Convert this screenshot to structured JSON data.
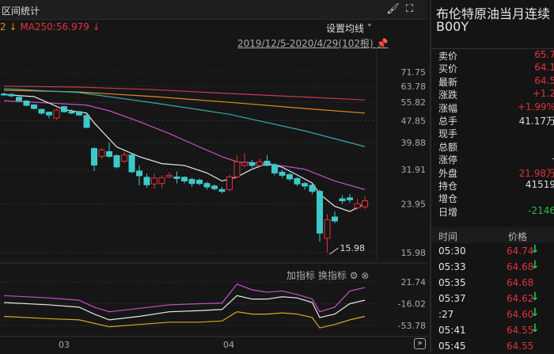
{
  "header": {
    "title": "区间统计",
    "brush_icon": "brush-icon",
    "fullscreen_icon": "fullscreen-icon"
  },
  "ma_legend": {
    "prefix": "2 ↓",
    "ma250": "MA250:56.979 ↓"
  },
  "set_ma": "设置均线 ˅",
  "range": "2019/12/5-2020/4/29(102根)",
  "indicator_tools": {
    "add": "加指标",
    "switch": "换指标"
  },
  "x_labels": [
    "03",
    "04"
  ],
  "colors": {
    "up": "#e0313d",
    "down": "#3ec9c9",
    "ma5": "#e8e8e8",
    "ma10": "#c84fc8",
    "ma20": "#3aa8a8",
    "ma60": "#e08a1e",
    "ma250": "#c83a55"
  },
  "chart_data": {
    "type": "candlestick",
    "y_ticks": [
      71.75,
      63.78,
      55.82,
      47.85,
      39.88,
      31.91,
      23.95,
      15.98
    ],
    "ylim": [
      15.98,
      71.75
    ],
    "min_marker": "15.98",
    "candles": [
      [
        59.8,
        59.3,
        60.5,
        58.8
      ],
      [
        59.6,
        58.9,
        60.2,
        58.2
      ],
      [
        58.2,
        56.6,
        58.6,
        55.8
      ],
      [
        56.4,
        54.4,
        56.8,
        54.0
      ],
      [
        54.6,
        53.0,
        55.0,
        52.6
      ],
      [
        52.6,
        51.0,
        53.0,
        50.4
      ],
      [
        51.4,
        50.2,
        51.6,
        48.8
      ],
      [
        48.9,
        52.3,
        53.0,
        48.2
      ],
      [
        53.8,
        51.6,
        54.2,
        51.2
      ],
      [
        51.6,
        51.0,
        52.6,
        50.6
      ],
      [
        51.6,
        50.2,
        52.0,
        49.8
      ],
      [
        50.0,
        45.3,
        50.4,
        45.0
      ],
      [
        38.0,
        33.1,
        38.4,
        31.5
      ],
      [
        35.6,
        37.5,
        38.2,
        34.8
      ],
      [
        37.0,
        35.6,
        40.0,
        35.2
      ],
      [
        35.8,
        32.6,
        36.2,
        32.2
      ],
      [
        34.2,
        36.0,
        37.0,
        33.6
      ],
      [
        36.0,
        31.3,
        36.4,
        31.0
      ],
      [
        31.5,
        30.3,
        33.0,
        28.0
      ],
      [
        29.9,
        28.1,
        30.8,
        27.4
      ],
      [
        28.3,
        29.7,
        30.8,
        27.2
      ],
      [
        28.4,
        29.8,
        30.4,
        27.4
      ],
      [
        30.0,
        30.4,
        31.2,
        29.6
      ],
      [
        30.0,
        29.6,
        31.4,
        28.4
      ],
      [
        29.9,
        29.0,
        30.2,
        28.4
      ],
      [
        29.4,
        28.4,
        29.8,
        27.6
      ],
      [
        29.2,
        28.4,
        29.6,
        28.0
      ],
      [
        28.4,
        27.6,
        28.8,
        27.0
      ],
      [
        27.8,
        27.2,
        28.2,
        26.8
      ],
      [
        27.0,
        26.6,
        27.6,
        26.2
      ],
      [
        27.0,
        30.0,
        30.6,
        26.6
      ],
      [
        30.0,
        34.0,
        36.0,
        29.6
      ],
      [
        33.0,
        33.8,
        36.5,
        32.5
      ],
      [
        33.8,
        33.0,
        34.6,
        32.4
      ],
      [
        33.0,
        34.0,
        35.0,
        32.6
      ],
      [
        34.2,
        33.0,
        36.0,
        32.8
      ],
      [
        33.2,
        31.0,
        33.6,
        30.4
      ],
      [
        31.2,
        30.4,
        31.8,
        29.8
      ],
      [
        30.6,
        29.5,
        31.0,
        29.0
      ],
      [
        29.6,
        28.3,
        30.0,
        27.8
      ],
      [
        28.4,
        27.8,
        28.8,
        27.0
      ],
      [
        28.0,
        26.6,
        28.4,
        26.0
      ],
      [
        26.6,
        18.8,
        27.0,
        17.5
      ],
      [
        18.0,
        21.0,
        22.0,
        15.98
      ],
      [
        21.5,
        20.8,
        22.5,
        20.4
      ],
      [
        25.0,
        24.6,
        25.8,
        24.0
      ],
      [
        25.2,
        24.8,
        26.0,
        24.2
      ],
      [
        23.2,
        24.0,
        25.0,
        22.8
      ],
      [
        23.4,
        24.6,
        25.6,
        23.0
      ]
    ],
    "ma": {
      "ma5": [
        [
          0,
          59.5
        ],
        [
          4,
          58.5
        ],
        [
          8,
          52.5
        ],
        [
          11,
          51.0
        ],
        [
          12,
          47.0
        ],
        [
          15,
          38.5
        ],
        [
          18,
          35.5
        ],
        [
          21,
          33.5
        ],
        [
          24,
          33.0
        ],
        [
          27,
          31.0
        ],
        [
          29,
          29.0
        ],
        [
          31,
          30.0
        ],
        [
          33,
          32.0
        ],
        [
          35,
          33.5
        ],
        [
          37,
          32.5
        ],
        [
          39,
          30.5
        ],
        [
          41,
          28.5
        ],
        [
          42,
          26.0
        ],
        [
          44,
          23.5
        ],
        [
          46,
          22.5
        ],
        [
          48,
          24.0
        ]
      ],
      "ma10": [
        [
          0,
          56.5
        ],
        [
          6,
          55.5
        ],
        [
          11,
          54.5
        ],
        [
          14,
          52.0
        ],
        [
          18,
          47.5
        ],
        [
          22,
          43.0
        ],
        [
          26,
          38.5
        ],
        [
          29,
          35.5
        ],
        [
          31,
          34.0
        ],
        [
          35,
          33.5
        ],
        [
          40,
          32.0
        ],
        [
          44,
          29.0
        ],
        [
          48,
          27.0
        ]
      ],
      "ma20": [
        [
          0,
          62.5
        ],
        [
          10,
          60.5
        ],
        [
          20,
          55.5
        ],
        [
          30,
          50.5
        ],
        [
          40,
          44.0
        ],
        [
          48,
          38.6
        ]
      ],
      "ma60": [
        [
          0,
          61.7
        ],
        [
          10,
          60.8
        ],
        [
          20,
          58.5
        ],
        [
          30,
          55.8
        ],
        [
          40,
          53.0
        ],
        [
          48,
          51.0
        ]
      ],
      "ma250": [
        [
          0,
          63.8
        ],
        [
          10,
          63.3
        ],
        [
          20,
          62.0
        ],
        [
          30,
          60.0
        ],
        [
          40,
          58.3
        ],
        [
          48,
          56.9
        ]
      ]
    },
    "indicator": {
      "y_ticks": [
        21.74,
        -16.02,
        -53.78
      ],
      "ylim": [
        -53.78,
        21.74
      ],
      "series": [
        {
          "name": "magenta",
          "values": [
            [
              0,
              -2
            ],
            [
              6,
              -6
            ],
            [
              10,
              -10
            ],
            [
              12,
              -22
            ],
            [
              14,
              -30
            ],
            [
              18,
              -24
            ],
            [
              22,
              -18
            ],
            [
              26,
              -16
            ],
            [
              29,
              -15
            ],
            [
              31,
              18
            ],
            [
              33,
              8
            ],
            [
              35,
              4
            ],
            [
              37,
              6
            ],
            [
              39,
              0
            ],
            [
              41,
              -8
            ],
            [
              42,
              -30
            ],
            [
              44,
              -22
            ],
            [
              46,
              6
            ],
            [
              48,
              12
            ]
          ]
        },
        {
          "name": "white",
          "values": [
            [
              0,
              -14
            ],
            [
              6,
              -18
            ],
            [
              10,
              -22
            ],
            [
              12,
              -34
            ],
            [
              14,
              -44
            ],
            [
              18,
              -38
            ],
            [
              22,
              -30
            ],
            [
              26,
              -28
            ],
            [
              29,
              -26
            ],
            [
              31,
              -2
            ],
            [
              33,
              -8
            ],
            [
              35,
              -8
            ],
            [
              37,
              -4
            ],
            [
              39,
              -6
            ],
            [
              41,
              -14
            ],
            [
              42,
              -40
            ],
            [
              44,
              -34
            ],
            [
              46,
              -16
            ],
            [
              48,
              -10
            ]
          ]
        },
        {
          "name": "yellow",
          "values": [
            [
              0,
              -38
            ],
            [
              6,
              -42
            ],
            [
              10,
              -44
            ],
            [
              12,
              -50
            ],
            [
              14,
              -56
            ],
            [
              18,
              -52
            ],
            [
              22,
              -48
            ],
            [
              26,
              -48
            ],
            [
              29,
              -46
            ],
            [
              31,
              -30
            ],
            [
              33,
              -34
            ],
            [
              35,
              -34
            ],
            [
              37,
              -32
            ],
            [
              39,
              -34
            ],
            [
              41,
              -40
            ],
            [
              42,
              -58
            ],
            [
              44,
              -52
            ],
            [
              46,
              -44
            ],
            [
              48,
              -38
            ]
          ]
        }
      ]
    }
  },
  "side": {
    "name": "布伦特原油当月连续",
    "code": "B00Y",
    "quote": [
      {
        "k": "卖价",
        "v": "65.7",
        "c": "red"
      },
      {
        "k": "买价",
        "v": "64.1",
        "c": "red"
      },
      {
        "k": "最新",
        "v": "64.5",
        "c": "red"
      },
      {
        "k": "涨跌",
        "v": "+1.2",
        "c": "red"
      },
      {
        "k": "涨幅",
        "v": "+1.99%",
        "c": "red"
      },
      {
        "k": "总手",
        "v": "41.17万",
        "c": "white"
      },
      {
        "k": "现手",
        "v": "",
        "c": "white"
      },
      {
        "k": "总额",
        "v": "",
        "c": "white"
      },
      {
        "k": "涨停",
        "v": "-",
        "c": "white"
      },
      {
        "k": "外盘",
        "v": "21.98万",
        "c": "red"
      },
      {
        "k": "持仓",
        "v": "41519",
        "c": "white"
      },
      {
        "k": "增仓",
        "v": "",
        "c": "white"
      },
      {
        "k": "日增",
        "v": "-2146",
        "c": "green"
      }
    ],
    "ticks_header": {
      "time": "时间",
      "price": "价格"
    },
    "ticks": [
      {
        "t": "05:30",
        "p": "64.74",
        "down": true
      },
      {
        "t": "05:33",
        "p": "64.68",
        "down": true
      },
      {
        "t": "05:35",
        "p": "64.68",
        "down": false
      },
      {
        "t": "05:37",
        "p": "64.62",
        "down": true
      },
      {
        "t": ":27",
        "p": "64.60",
        "down": true
      },
      {
        "t": "05:41",
        "p": "64.55",
        "down": true
      },
      {
        "t": "05:45",
        "p": "64.55",
        "down": false
      }
    ]
  }
}
